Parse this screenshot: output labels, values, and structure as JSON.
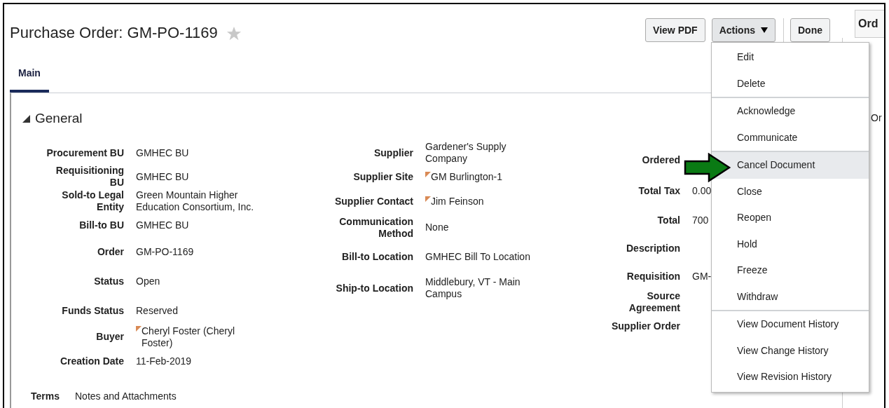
{
  "page": {
    "title": "Purchase Order: GM-PO-1169",
    "favorite": false
  },
  "toolbar": {
    "buttons": [
      {
        "label": "View PDF",
        "kind": "plain"
      },
      {
        "label": "Actions",
        "kind": "menu",
        "expanded": true
      },
      {
        "label": "Done",
        "kind": "plain"
      }
    ]
  },
  "tabs": [
    {
      "label": "Main",
      "selected": true
    }
  ],
  "section": {
    "title": "General",
    "expanded": true
  },
  "columns": [
    [
      {
        "label": "Procurement BU",
        "value": "GMHEC BU",
        "linked": false
      },
      {
        "label": "Requisitioning BU",
        "value": "GMHEC BU",
        "linked": false
      },
      {
        "label": "Sold-to Legal Entity",
        "value": "Green Mountain Higher Education Consortium, Inc.",
        "linked": false
      },
      {
        "label": "Bill-to BU",
        "value": "GMHEC BU",
        "linked": false
      },
      {
        "label": "Order",
        "value": "GM-PO-1169",
        "linked": false
      },
      {
        "label": "Status",
        "value": "Open",
        "linked": false
      },
      {
        "label": "Funds Status",
        "value": "Reserved",
        "linked": false
      },
      {
        "label": "Buyer",
        "value": "Cheryl Foster (Cheryl Foster)",
        "linked": true
      },
      {
        "label": "Creation Date",
        "value": "11-Feb-2019",
        "linked": false
      }
    ],
    [
      {
        "label": "Supplier",
        "value": "Gardener's Supply Company",
        "linked": false
      },
      {
        "label": "Supplier Site",
        "value": "GM Burlington-1",
        "linked": true
      },
      {
        "label": "Supplier Contact",
        "value": "Jim Feinson",
        "linked": true
      },
      {
        "label": "Communication Method",
        "value": "None",
        "linked": false
      },
      {
        "label": "Bill-to Location",
        "value": "GMHEC Bill To Location",
        "linked": false
      },
      {
        "label": "Ship-to Location",
        "value": "Middlebury, VT - Main Campus",
        "linked": false
      }
    ],
    [
      {
        "label": "Ordered",
        "linked": false
      },
      {
        "label": "Total Tax",
        "value": "0.00",
        "linked": false
      },
      {
        "label": "Total",
        "value": "700",
        "linked": false
      },
      {
        "label": "Description",
        "linked": false
      },
      {
        "label": "Requisition",
        "value": "GM-",
        "linked": false
      },
      {
        "label": "Source Agreement",
        "linked": false
      },
      {
        "label": "Supplier Order",
        "linked": false
      }
    ]
  ],
  "bottom_tabs": [
    {
      "label": "Terms",
      "selected": false
    },
    {
      "label": "Notes and Attachments",
      "selected": false
    }
  ],
  "actions_menu": [
    [
      {
        "label": "Edit",
        "selected": false
      },
      {
        "label": "Delete",
        "selected": false
      }
    ],
    [
      {
        "label": "Acknowledge",
        "selected": false
      },
      {
        "label": "Communicate",
        "selected": false
      }
    ],
    [
      {
        "label": "Cancel Document",
        "selected": true
      },
      {
        "label": "Close",
        "selected": false
      },
      {
        "label": "Reopen",
        "selected": false
      },
      {
        "label": "Hold",
        "selected": false
      },
      {
        "label": "Freeze",
        "selected": false
      },
      {
        "label": "Withdraw",
        "selected": false
      }
    ],
    [
      {
        "label": "View Document History",
        "selected": false
      },
      {
        "label": "View Change History",
        "selected": false
      },
      {
        "label": "View Revision History",
        "selected": false
      }
    ]
  ],
  "side_panel": {
    "tab": "Ord",
    "text": "Or"
  }
}
